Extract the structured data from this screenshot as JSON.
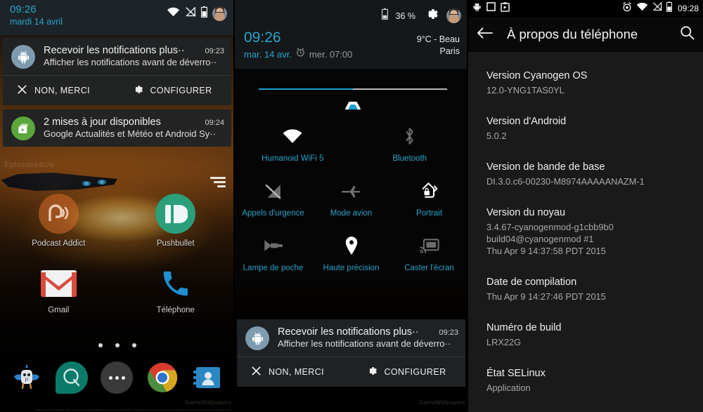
{
  "panel1": {
    "name": "notification-shade-home",
    "shade": {
      "time": "09:26",
      "date": "mardi 14 avril",
      "status_icons": [
        "wifi-icon",
        "signal-off-icon",
        "battery-icon",
        "user-avatar"
      ]
    },
    "notifications": [
      {
        "icon": "android-robot-icon",
        "title": "Recevoir les notifications plus··",
        "time": "09:23",
        "subtitle": "Afficher les notifications avant de déverro··",
        "actions": [
          {
            "icon": "close-icon",
            "label": "NON, MERCI"
          },
          {
            "icon": "gear-icon",
            "label": "CONFIGURER"
          }
        ]
      },
      {
        "icon": "play-store-updates-icon",
        "title": "2 mises à jour disponibles",
        "time": "09:24",
        "subtitle": "Google Actualités et Météo et Android Sy··"
      }
    ],
    "wallpaper_text": "Episodes4cre",
    "wallpaper_watermark": "GameWallpapers",
    "wallpaper_legal": "These do not permit software online. Welcome to GameWallpapers.com. Artwork & Wallpapers, published each week. No part of files collections may be reproduced or transmitted in any form or by any means.",
    "apps": [
      {
        "label": "Podcast Addict",
        "icon": "podcast-addict-icon"
      },
      {
        "label": "Pushbullet",
        "icon": "pushbullet-icon"
      },
      {
        "label": "Gmail",
        "icon": "gmail-icon"
      },
      {
        "label": "Téléphone",
        "icon": "phone-icon"
      }
    ],
    "page_dots": 3,
    "page_dot_active": 1,
    "dock": [
      {
        "icon": "plume-twitter-icon"
      },
      {
        "icon": "quizduell-icon"
      },
      {
        "icon": "app-drawer-icon"
      },
      {
        "icon": "chrome-icon"
      },
      {
        "icon": "contacts-icon"
      }
    ]
  },
  "panel2": {
    "name": "quick-settings",
    "status": {
      "battery_icon": "battery-icon",
      "battery_pct": "36 %",
      "gear_icon": "gear-icon",
      "avatar": "user-avatar"
    },
    "time": "09:26",
    "date": "mar. 14 avr.",
    "alarm_icon": "alarm-clock-icon",
    "alarm": "mer. 07:00",
    "weather": "9°C - Beau",
    "location": "Paris",
    "brightness": {
      "name": "brightness-slider",
      "value": 50
    },
    "tiles": [
      {
        "label": "Humanoid WiFi 5",
        "icon": "wifi-icon",
        "state": "on"
      },
      {
        "label": "Bluetooth",
        "icon": "bluetooth-icon",
        "state": "off"
      },
      {
        "label": "Appels d'urgence",
        "icon": "signal-off-icon",
        "state": "off"
      },
      {
        "label": "Mode avion",
        "icon": "airplane-icon",
        "state": "off"
      },
      {
        "label": "Portrait",
        "icon": "rotation-lock-icon",
        "state": "on"
      },
      {
        "label": "Lampe de poche",
        "icon": "flashlight-icon",
        "state": "off"
      },
      {
        "label": "Haute précision",
        "icon": "location-pin-icon",
        "state": "on"
      },
      {
        "label": "Caster l'écran",
        "icon": "cast-screen-icon",
        "state": "off"
      }
    ],
    "notification": {
      "icon": "android-robot-icon",
      "title": "Recevoir les notifications plus··",
      "time": "09:23",
      "subtitle": "Afficher les notifications avant de déverro··",
      "actions": [
        {
          "icon": "close-icon",
          "label": "NON, MERCI"
        },
        {
          "icon": "gear-icon",
          "label": "CONFIGURER"
        }
      ]
    }
  },
  "panel3": {
    "name": "about-phone-settings",
    "statusbar": {
      "left_icons": [
        "android-debug-icon",
        "screenshot-icon",
        "clipboard-icon"
      ],
      "right_icons": [
        "alarm-clock-icon",
        "wifi-icon",
        "signal-off-icon",
        "battery-icon"
      ],
      "time": "09:28"
    },
    "appbar": {
      "back_icon": "back-arrow-icon",
      "title": "À propos du téléphone",
      "search_icon": "search-icon"
    },
    "items": [
      {
        "label": "Version Cyanogen OS",
        "value": "12.0-YNG1TAS0YL"
      },
      {
        "label": "Version d'Android",
        "value": "5.0.2"
      },
      {
        "label": "Version de bande de base",
        "value": "DI.3.0.c6-00230-M8974AAAAANAZM-1"
      },
      {
        "label": "Version du noyau",
        "value": "3.4.67-cyanogenmod-g1cbb9b0\nbuild04@cyanogenmod #1\nThu Apr 9 14:37:58 PDT 2015"
      },
      {
        "label": "Date de compilation",
        "value": "Thu Apr  9 14:27:46 PDT 2015"
      },
      {
        "label": "Numéro de build",
        "value": "LRX22G"
      },
      {
        "label": "État SELinux",
        "value": "Application"
      }
    ]
  },
  "colors": {
    "accent_cyan": "#2aa3c9",
    "slider_blue": "#1a9fd4",
    "shade_bg": "#202325",
    "settings_bg": "#1a1a1a",
    "android_green": "#5aa83c"
  }
}
